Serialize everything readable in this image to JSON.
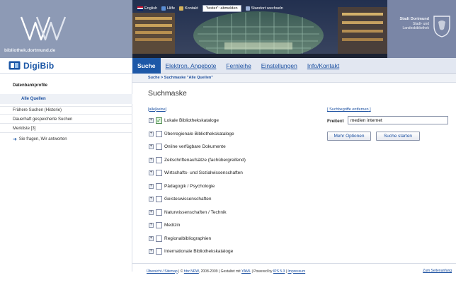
{
  "header": {
    "brand_url": "bibliothek.dortmund.de",
    "city_name": "Stadt Dortmund",
    "city_sub_1": "Stadt- und",
    "city_sub_2": "Landesbibliothek"
  },
  "topbar": {
    "english": "English",
    "help": "Hilfe",
    "contact": "Kontakt",
    "logout": "\"tester\": abmelden",
    "location": "Standort wechseln"
  },
  "sidebar": {
    "app_title": "DigiBib",
    "section_heading": "Datenbankprofile",
    "active_profile": "Alle Quellen",
    "items": [
      "Frühere Suchen (Historie)",
      "Dauerhaft gespeicherte Suchen",
      "Merkliste [3]"
    ],
    "feedback_link": "Sie fragen, Wir antworten"
  },
  "tabs": [
    {
      "label": "Suche",
      "active": true
    },
    {
      "label": "Elektron. Angebote",
      "active": false
    },
    {
      "label": "Fernleihe",
      "active": false
    },
    {
      "label": "Einstellungen",
      "active": false
    },
    {
      "label": "Info/Kontakt",
      "active": false
    }
  ],
  "breadcrumb": "Suche > Suchmaske \"Alle Quellen\"",
  "main": {
    "title": "Suchmaske",
    "select_all": "alle",
    "select_none": "keine",
    "sources": [
      {
        "label": "Lokale Bibliothekskataloge",
        "checked": true
      },
      {
        "label": "Überregionale Bibliothekskataloge",
        "checked": false
      },
      {
        "label": "Online verfügbare Dokumente",
        "checked": false
      },
      {
        "label": "Zeitschriftenaufsätze (fachübergreifend)",
        "checked": false
      },
      {
        "label": "Wirtschafts- und Sozialwissenschaften",
        "checked": false
      },
      {
        "label": "Pädagogik / Psychologie",
        "checked": false
      },
      {
        "label": "Geisteswissenschaften",
        "checked": false
      },
      {
        "label": "Naturwissenschaften / Technik",
        "checked": false
      },
      {
        "label": "Medizin",
        "checked": false
      },
      {
        "label": "Regionalbibliographien",
        "checked": false
      },
      {
        "label": "Internationale Bibliothekskataloge",
        "checked": false
      }
    ],
    "clear_terms": "Suchbegriffe entfernen",
    "freitext_label": "Freitext",
    "freitext_value": "medien internet",
    "more_options": "Mehr Optionen",
    "start_search": "Suche starten"
  },
  "footer": {
    "sitemap": "Übersicht / Sitemap",
    "copy_prefix": "| ©",
    "hbz": "hbz NRW",
    "years": ", 2008-2009 | Gestaltet mit",
    "yaml": "YAML",
    "powered": "| Powered by",
    "ips": "IPS 5.3",
    "sep": "|",
    "impressum": "Impressum",
    "to_top": "Zum Seitenanfang"
  },
  "colors": {
    "accent": "#1d58a7",
    "brand_panel": "#8d9ab5",
    "tab_bar": "#e2e7f1"
  }
}
